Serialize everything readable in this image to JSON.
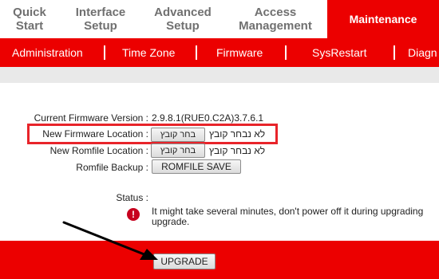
{
  "tabs": [
    {
      "line1": "Quick",
      "line2": "Start"
    },
    {
      "line1": "Interface",
      "line2": "Setup"
    },
    {
      "line1": "Advanced",
      "line2": "Setup"
    },
    {
      "line1": "Access",
      "line2": "Management"
    },
    {
      "line1": "Maintenance",
      "line2": ""
    }
  ],
  "subnav": [
    "Administration",
    "Time Zone",
    "Firmware",
    "SysRestart",
    "Diagn"
  ],
  "firmware": {
    "current_label": "Current Firmware Version :",
    "current_value": "2.9.8.1(RUE0.C2A)3.7.6.1",
    "new_fw_label": "New Firmware Location :",
    "new_rom_label": "New Romfile Location :",
    "choose_file_button": "בחר קובץ",
    "no_file_text": "לא נבחר קובץ",
    "backup_label": "Romfile Backup :",
    "backup_button": "ROMFILE SAVE"
  },
  "status": {
    "label": "Status :",
    "message_line1": "It might take several minutes, don't power off it during upgrading",
    "message_line2": "upgrade."
  },
  "upgrade_button": "UPGRADE",
  "colors": {
    "accent": "#ec0000",
    "highlight": "#e8242a"
  }
}
